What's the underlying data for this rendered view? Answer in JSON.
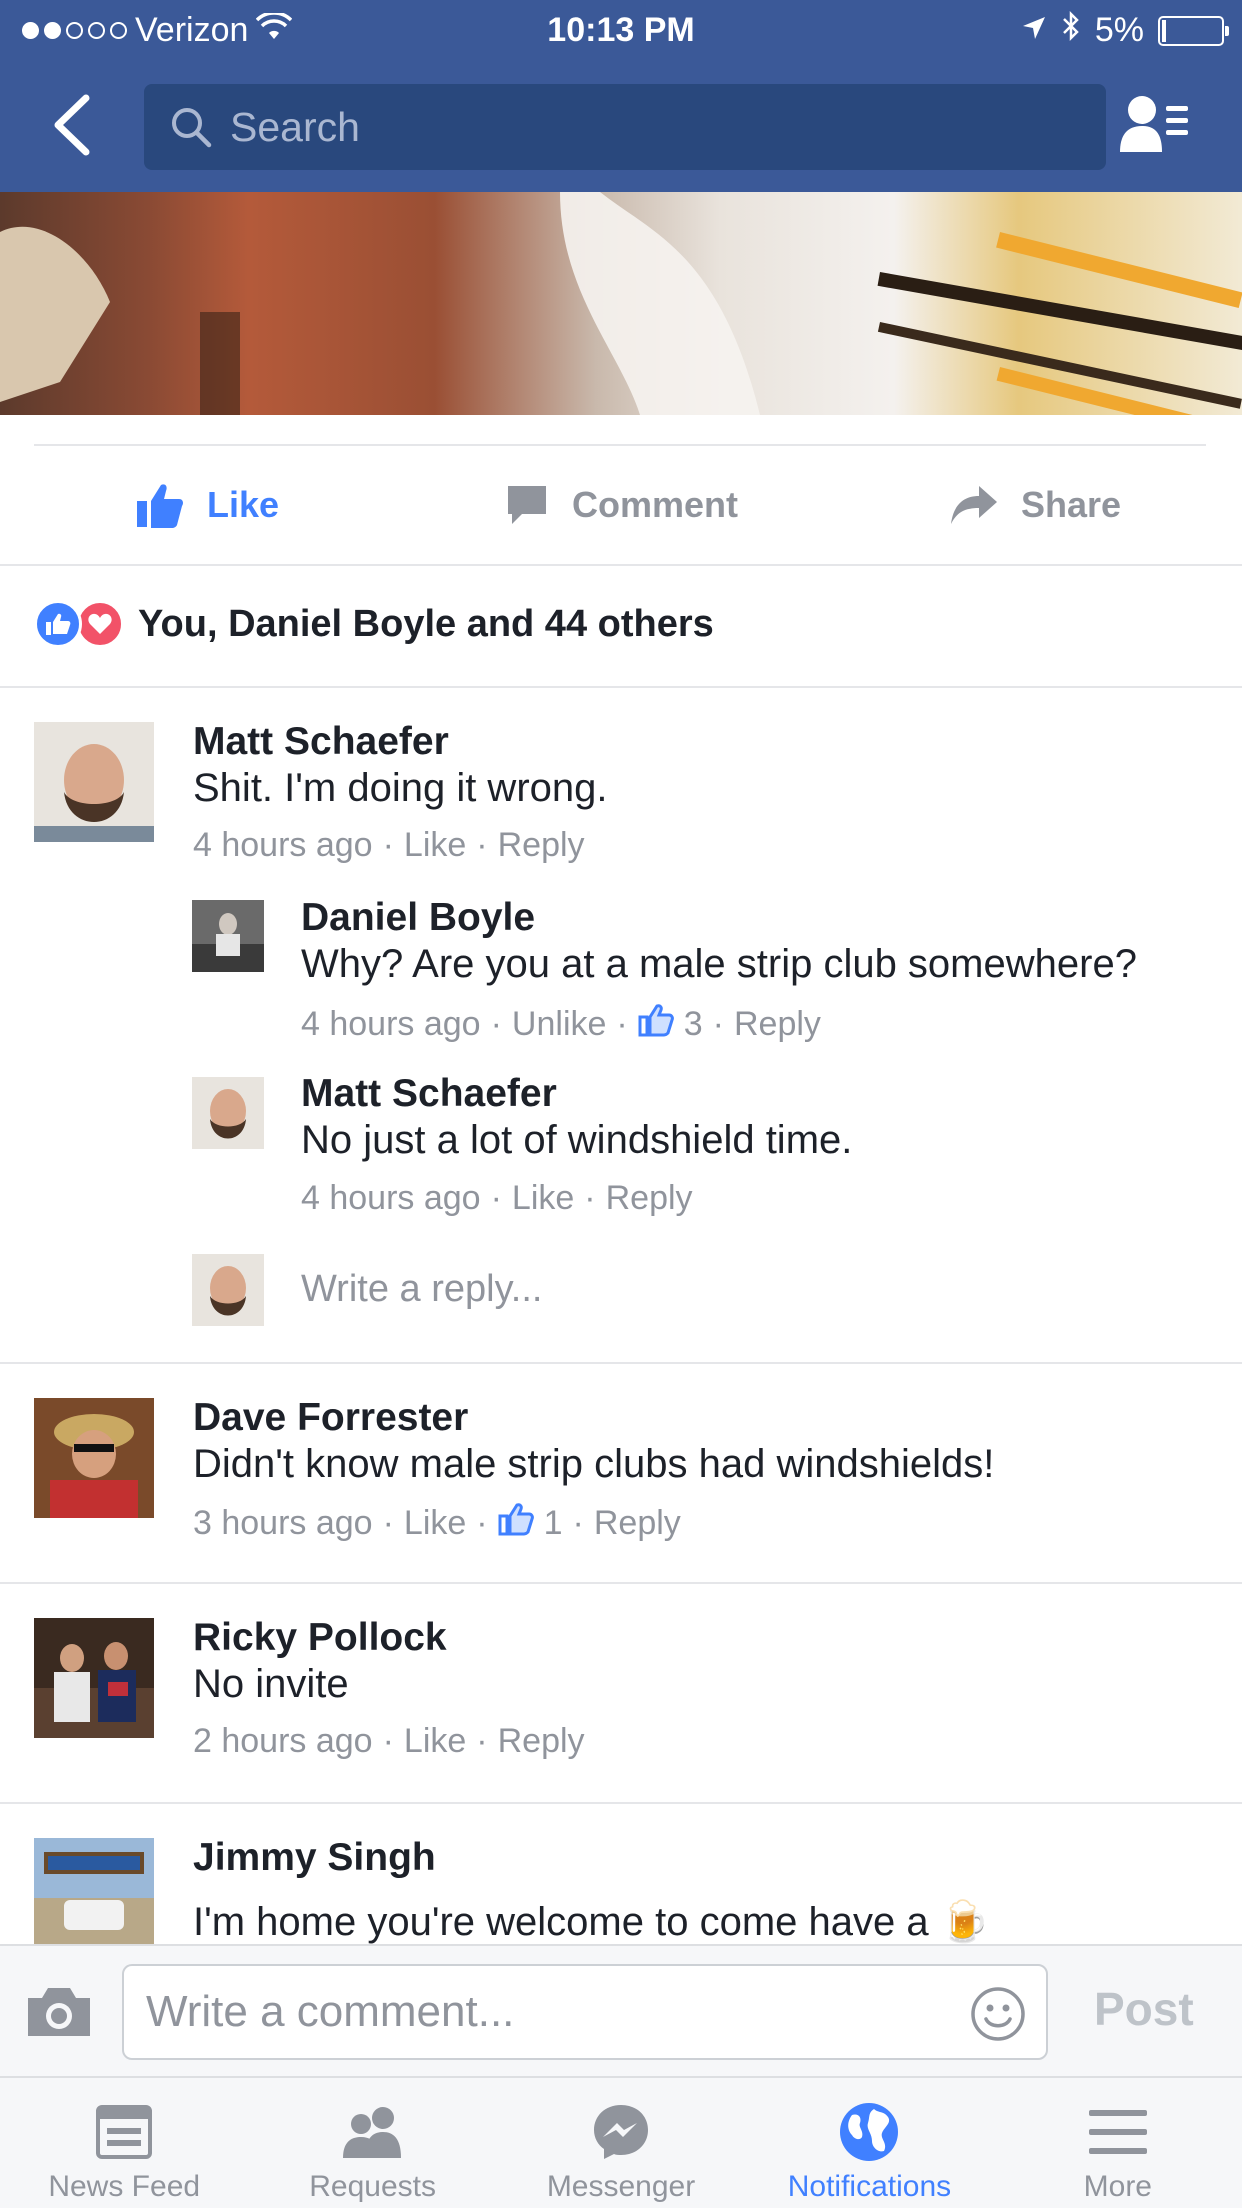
{
  "status_bar": {
    "carrier": "Verizon",
    "time": "10:13 PM",
    "battery": "5%"
  },
  "search": {
    "placeholder": "Search"
  },
  "actions": {
    "like": "Like",
    "comment": "Comment",
    "share": "Share"
  },
  "reactions": {
    "summary": "You, Daniel Boyle and 44 others"
  },
  "comments": [
    {
      "name": "Matt Schaefer",
      "text": "Shit. I'm doing it wrong.",
      "time": "4 hours ago",
      "like": "Like",
      "reply": "Reply"
    },
    {
      "name": "Daniel Boyle",
      "text": "Why? Are you at a male strip club somewhere?",
      "time": "4 hours ago",
      "like": "Unlike",
      "likes": "3",
      "reply": "Reply"
    },
    {
      "name": "Matt Schaefer",
      "text": "No just a lot of windshield time.",
      "time": "4 hours ago",
      "like": "Like",
      "reply": "Reply"
    },
    {
      "name": "Dave Forrester",
      "text": "Didn't know male strip clubs had windshields!",
      "time": "3 hours ago",
      "like": "Like",
      "likes": "1",
      "reply": "Reply"
    },
    {
      "name": "Ricky Pollock",
      "text": "No invite",
      "time": "2 hours ago",
      "like": "Like",
      "reply": "Reply"
    },
    {
      "name": "Jimmy Singh",
      "text": "I'm home you're welcome to come have a 🍺"
    }
  ],
  "write_reply": {
    "placeholder": "Write a reply..."
  },
  "composer": {
    "placeholder": "Write a comment...",
    "post_label": "Post"
  },
  "tabs": [
    {
      "label": "News Feed"
    },
    {
      "label": "Requests"
    },
    {
      "label": "Messenger"
    },
    {
      "label": "Notifications"
    },
    {
      "label": "More"
    }
  ],
  "colors": {
    "header": "#3b5998",
    "accent": "#4080ff",
    "meta": "#90949c",
    "love": "#f25268"
  }
}
